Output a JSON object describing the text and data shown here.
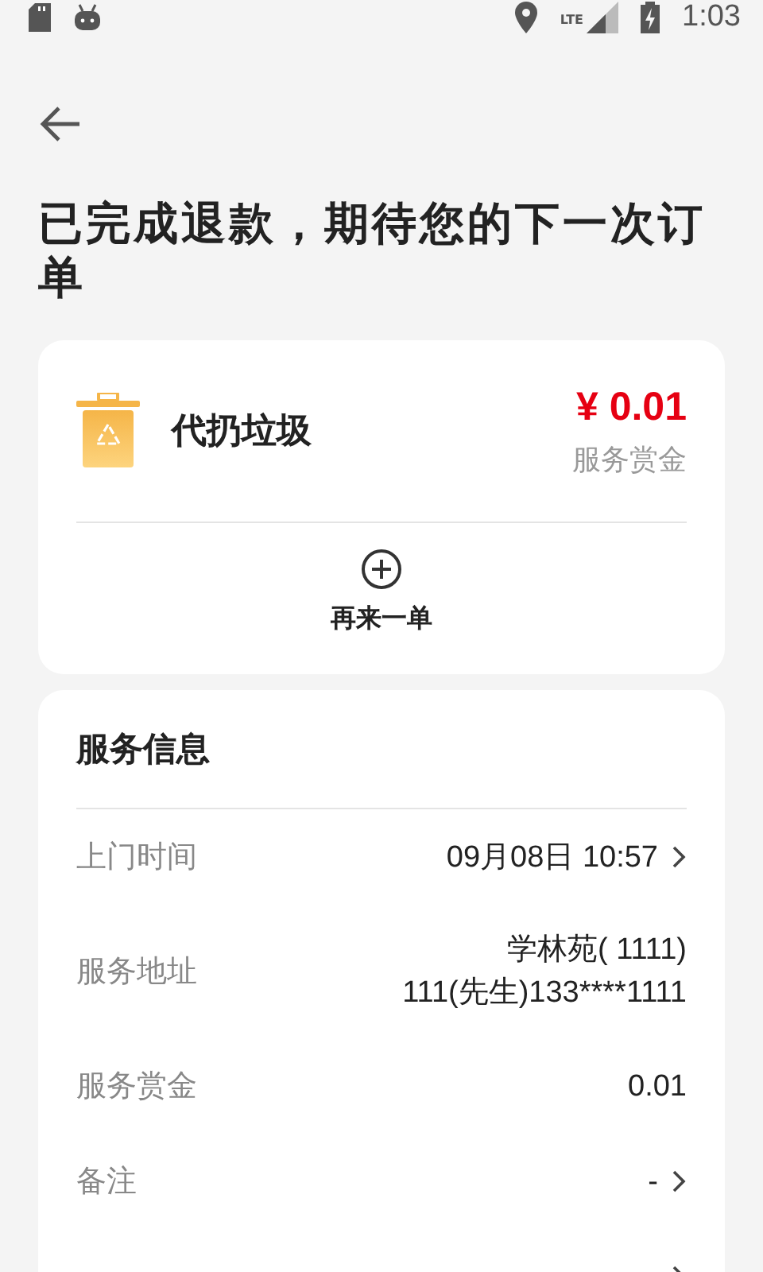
{
  "status_bar": {
    "time": "1:03",
    "network": "LTE"
  },
  "title": "已完成退款，期待您的下一次订单",
  "order": {
    "name": "代扔垃圾",
    "price": "¥ 0.01",
    "price_label": "服务赏金",
    "reorder": "再来一单"
  },
  "info": {
    "title": "服务信息",
    "rows": [
      {
        "label": "上门时间",
        "value": [
          "09月08日 10:57"
        ],
        "chevron": true
      },
      {
        "label": "服务地址",
        "value": [
          "学林苑( 1111)",
          "111(先生)133****1111"
        ],
        "chevron": false
      },
      {
        "label": "服务赏金",
        "value": [
          "0.01"
        ],
        "chevron": false
      },
      {
        "label": "备注",
        "value": [
          "-"
        ],
        "chevron": true
      },
      {
        "value": [],
        "chevron": true
      }
    ]
  }
}
